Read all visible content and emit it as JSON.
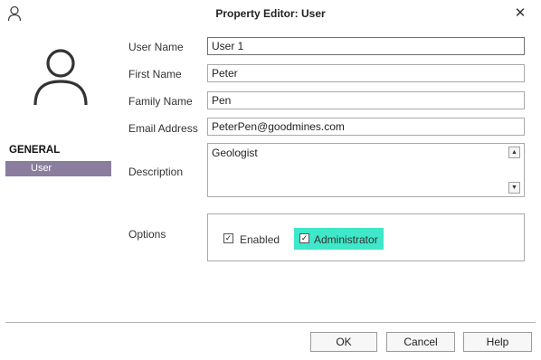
{
  "window": {
    "title": "Property Editor:  User",
    "close_glyph": "✕"
  },
  "sidebar": {
    "section_label": "GENERAL",
    "items": [
      {
        "label": "User",
        "selected": true
      }
    ]
  },
  "form": {
    "user_name": {
      "label": "User Name",
      "value": "User 1"
    },
    "first_name": {
      "label": "First Name",
      "value": "Peter"
    },
    "family_name": {
      "label": "Family Name",
      "value": "Pen"
    },
    "email": {
      "label": "Email Address",
      "value": "PeterPen@goodmines.com"
    },
    "description": {
      "label": "Description",
      "value": "Geologist",
      "scroll_up_glyph": "▲",
      "scroll_down_glyph": "▼"
    },
    "options": {
      "label": "Options",
      "enabled": {
        "label": "Enabled",
        "checked": true
      },
      "administrator": {
        "label": "Administrator",
        "checked": true,
        "highlight_color": "#3ee8c9"
      }
    }
  },
  "footer": {
    "ok_label": "OK",
    "cancel_label": "Cancel",
    "help_label": "Help"
  },
  "colors": {
    "nav_selected_bg": "#8a7d9e",
    "highlight": "#3ee8c9"
  },
  "icons": {
    "title_icon": "user-outline-icon",
    "avatar": "user-avatar-icon",
    "checkmark": "✓"
  }
}
